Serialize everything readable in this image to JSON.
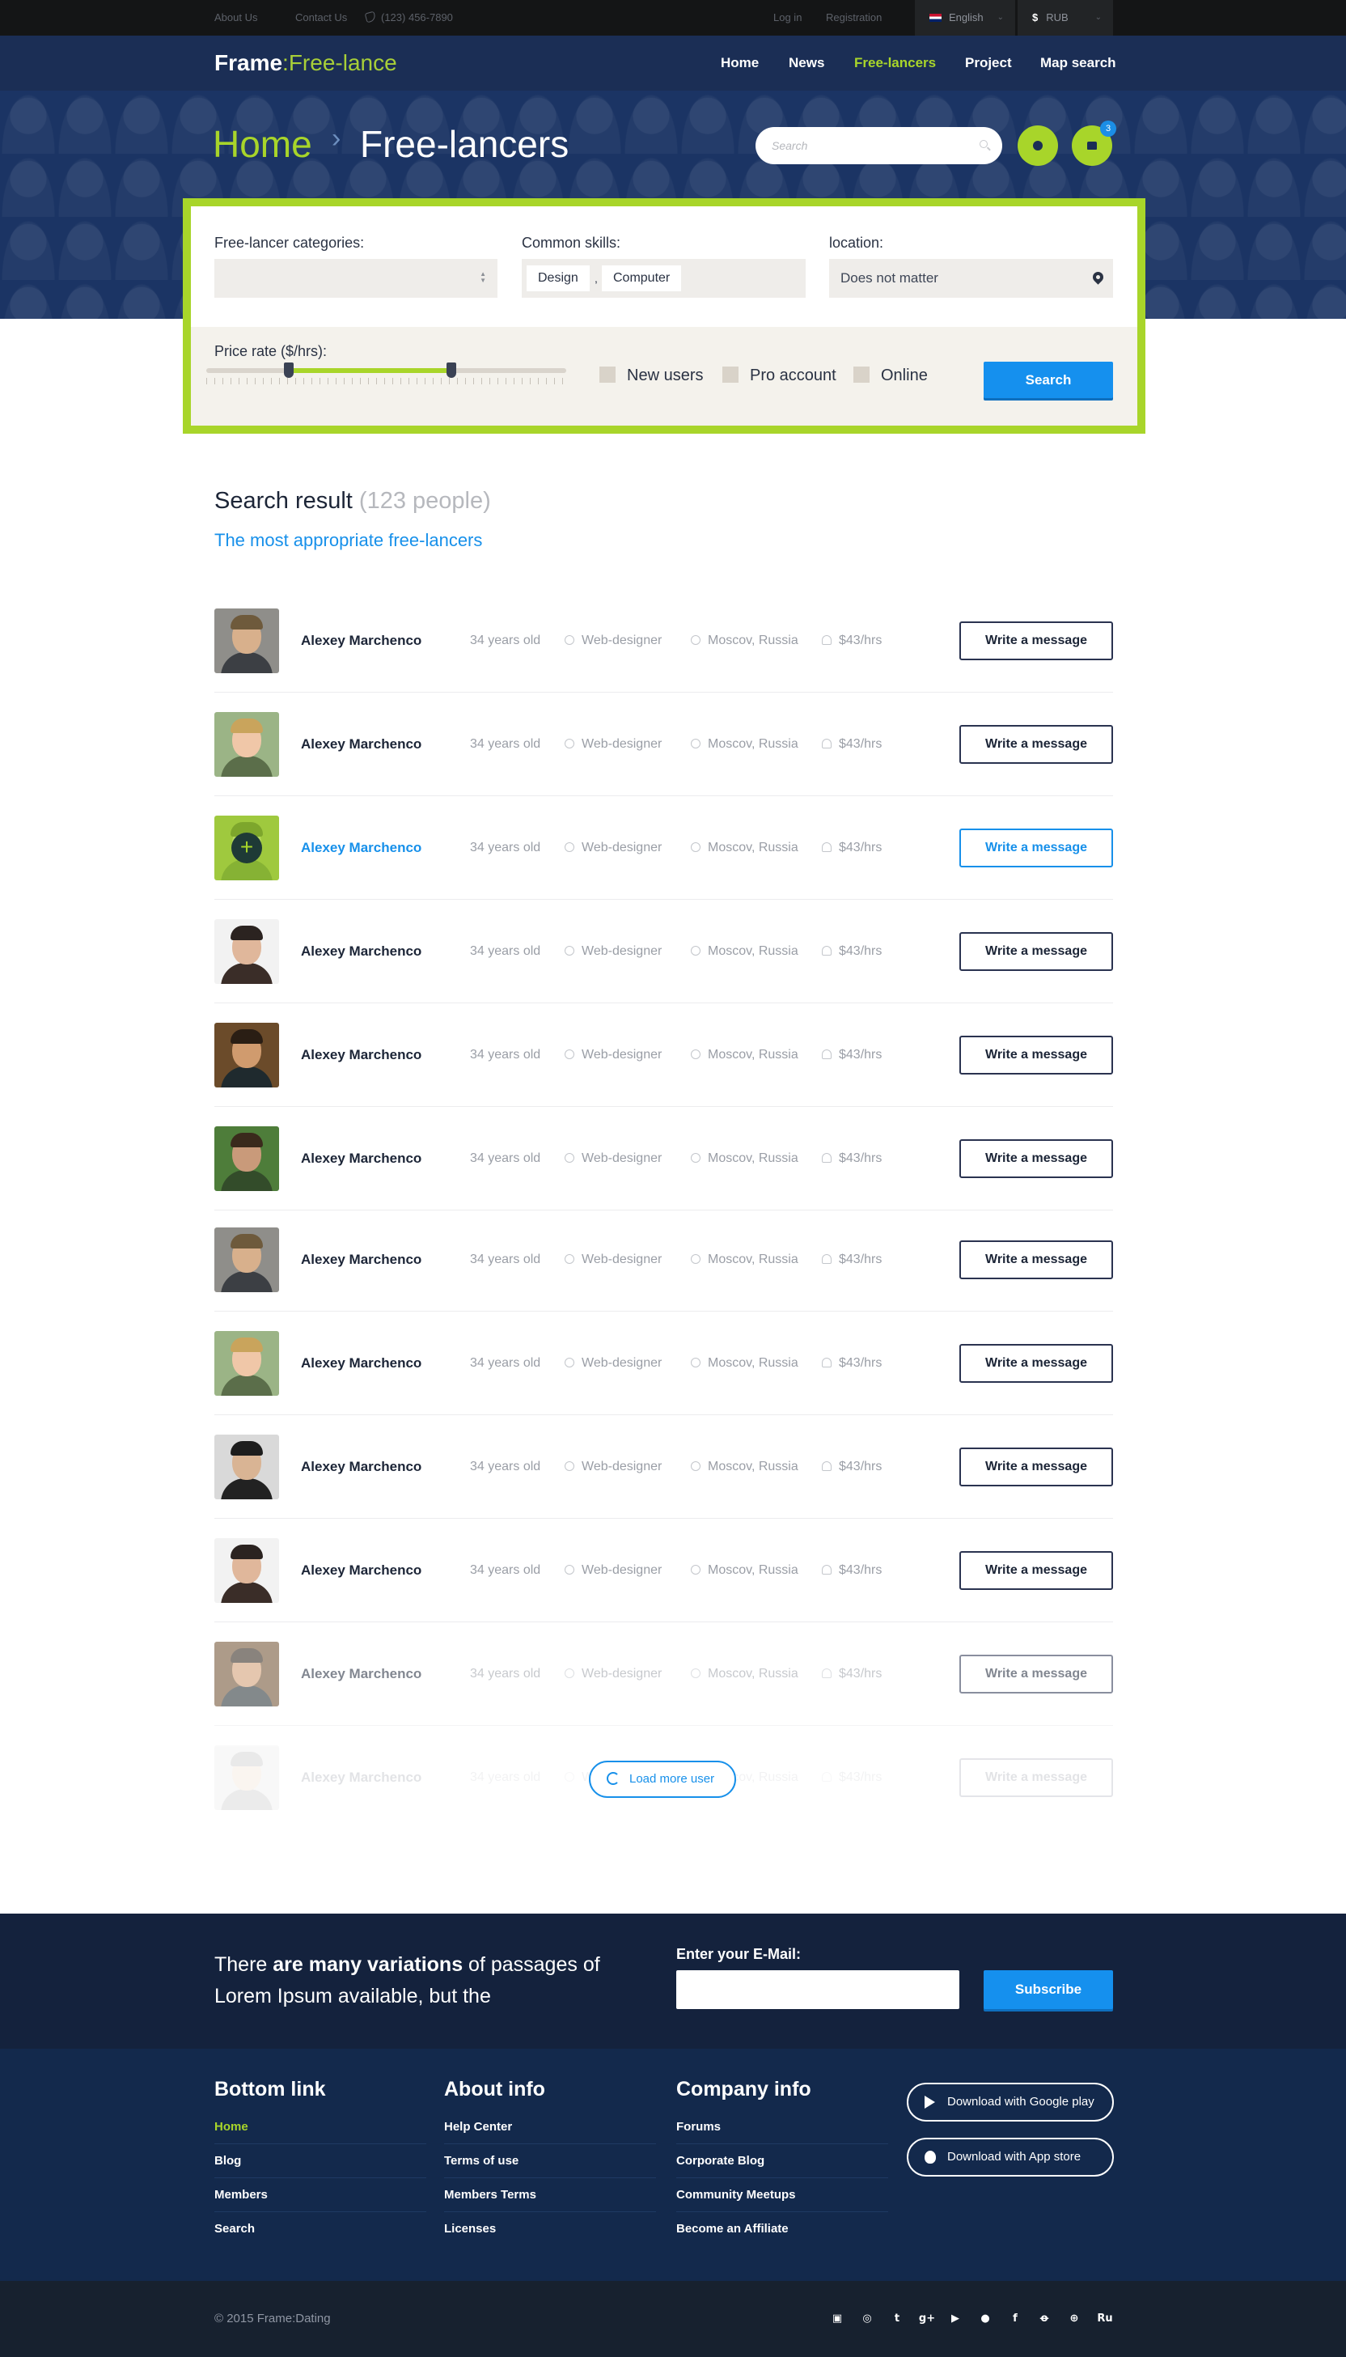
{
  "topbar": {
    "about": "About Us",
    "contact": "Contact Us",
    "phone": "(123) 456-7890",
    "login": "Log in",
    "registration": "Registration",
    "language": "English",
    "currency": "RUB",
    "currency_symbol": "$"
  },
  "header": {
    "logo_bold": "Frame",
    "logo_sep": ":",
    "logo_light": "Free-lance",
    "nav": [
      "Home",
      "News",
      "Free-lancers",
      "Project",
      "Map search"
    ],
    "active_nav": "Free-lancers",
    "breadcrumb_home": "Home",
    "breadcrumb_sep": "›",
    "breadcrumb_current": "Free-lancers",
    "search_placeholder": "Search",
    "folder_badge": "3"
  },
  "filter": {
    "categories_label": "Free-lancer categories:",
    "categories_value": "",
    "skills_label": "Common skills:",
    "skills": [
      "Design",
      "Computer"
    ],
    "skills_separator": ",",
    "location_label": "location:",
    "location_value": "Does not matter",
    "price_label": "Price rate ($/hrs):",
    "price_range_fraction": [
      0.23,
      0.68
    ],
    "checkboxes": [
      "New users",
      "Pro account",
      "Online"
    ],
    "search_button": "Search"
  },
  "results": {
    "title": "Search result",
    "count": "(123 people)",
    "subtitle": "The most appropriate free-lancers",
    "rows": [
      {
        "name": "Alexey Marchenco",
        "age": "34 years old",
        "role": "Web-designer",
        "location": "Moscov, Russia",
        "rate": "$43/hrs",
        "button": "Write a message"
      },
      {
        "name": "Alexey Marchenco",
        "age": "34 years old",
        "role": "Web-designer",
        "location": "Moscov, Russia",
        "rate": "$43/hrs",
        "button": "Write a message"
      },
      {
        "name": "Alexey Marchenco",
        "age": "34 years old",
        "role": "Web-designer",
        "location": "Moscov, Russia",
        "rate": "$43/hrs",
        "button": "Write a message"
      },
      {
        "name": "Alexey Marchenco",
        "age": "34 years old",
        "role": "Web-designer",
        "location": "Moscov, Russia",
        "rate": "$43/hrs",
        "button": "Write a message"
      },
      {
        "name": "Alexey Marchenco",
        "age": "34 years old",
        "role": "Web-designer",
        "location": "Moscov, Russia",
        "rate": "$43/hrs",
        "button": "Write a message"
      },
      {
        "name": "Alexey Marchenco",
        "age": "34 years old",
        "role": "Web-designer",
        "location": "Moscov, Russia",
        "rate": "$43/hrs",
        "button": "Write a message"
      },
      {
        "name": "Alexey Marchenco",
        "age": "34 years old",
        "role": "Web-designer",
        "location": "Moscov, Russia",
        "rate": "$43/hrs",
        "button": "Write a message"
      },
      {
        "name": "Alexey Marchenco",
        "age": "34 years old",
        "role": "Web-designer",
        "location": "Moscov, Russia",
        "rate": "$43/hrs",
        "button": "Write a message"
      },
      {
        "name": "Alexey Marchenco",
        "age": "34 years old",
        "role": "Web-designer",
        "location": "Moscov, Russia",
        "rate": "$43/hrs",
        "button": "Write a message"
      },
      {
        "name": "Alexey Marchenco",
        "age": "34 years old",
        "role": "Web-designer",
        "location": "Moscov, Russia",
        "rate": "$43/hrs",
        "button": "Write a message"
      },
      {
        "name": "Alexey Marchenco",
        "age": "34 years old",
        "role": "Web-designer",
        "location": "Moscov, Russia",
        "rate": "$43/hrs",
        "button": "Write a message"
      },
      {
        "name": "Alexey Marchenco",
        "age": "34 years old",
        "role": "Web-designer",
        "location": "Moscov, Russia",
        "rate": "$43/hrs",
        "button": "Write a message"
      }
    ],
    "load_more": "Load more user"
  },
  "subscribe": {
    "text_pre": "There ",
    "text_bold": "are many variations",
    "text_post": " of passages of Lorem Ipsum available, but the",
    "email_label": "Enter your E-Mail:",
    "email_value": "",
    "button": "Subscribe"
  },
  "footer": {
    "columns": [
      {
        "title": "Bottom link",
        "links": [
          "Home",
          "Blog",
          "Members",
          "Search"
        ]
      },
      {
        "title": "About info",
        "links": [
          "Help Center",
          "Terms of use",
          "Members Terms",
          "Licenses"
        ]
      },
      {
        "title": "Company info",
        "links": [
          "Forums",
          "Corporate Blog",
          "Community Meetups",
          "Become an Affiliate"
        ]
      }
    ],
    "google_play": "Download with Google play",
    "app_store": "Download with App store",
    "copyright": "© 2015 Frame:Dating",
    "social_icons": [
      "blogger-icon",
      "dribbble-icon",
      "tumblr-icon",
      "google-plus-icon",
      "youtube-icon",
      "skype-icon",
      "facebook-icon",
      "odnoklassniki-icon",
      "globe-icon",
      "ru-icon"
    ],
    "social_ru": "Ru"
  },
  "colors": {
    "accent_green": "#a8d52a",
    "accent_blue": "#1790ea",
    "navy": "#1b2e55",
    "dark": "#141516"
  }
}
